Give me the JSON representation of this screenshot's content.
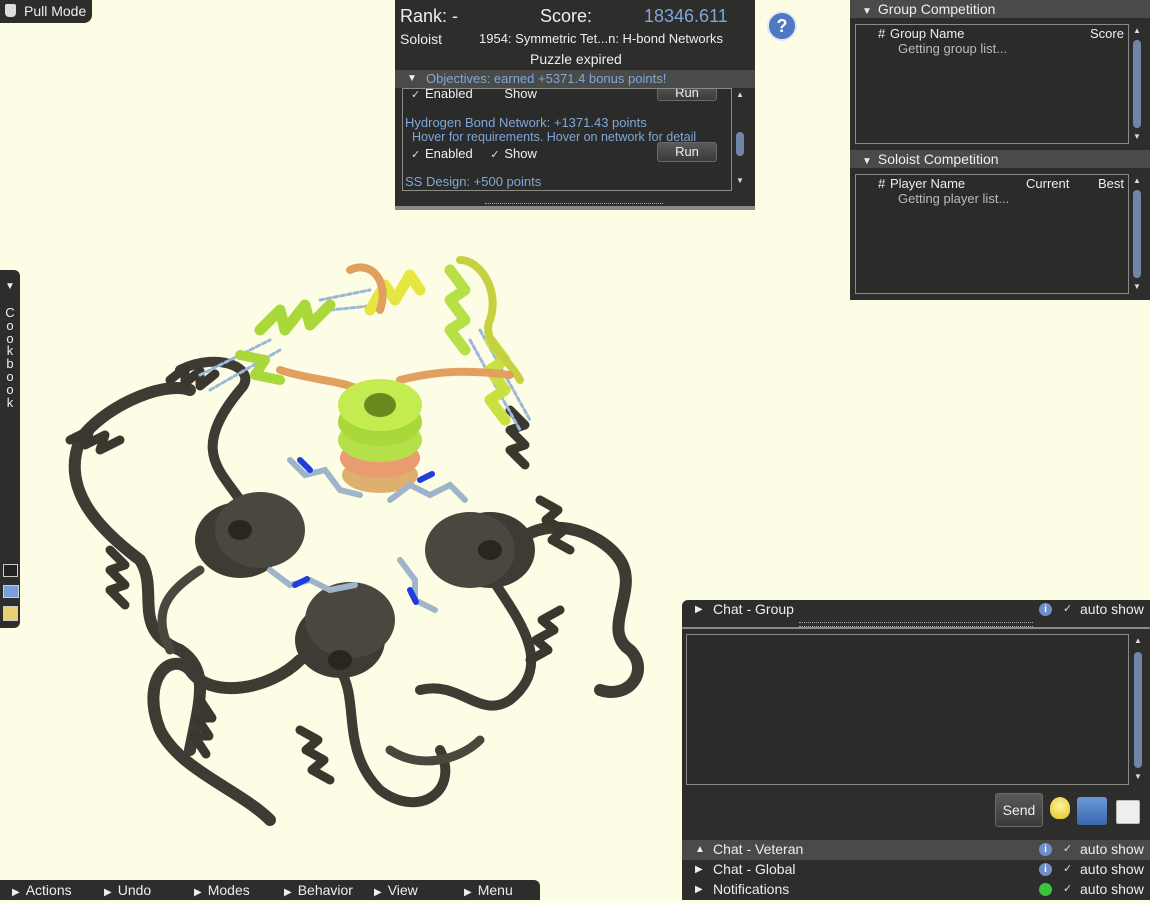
{
  "mode_button": {
    "label": "Pull Mode"
  },
  "score_panel": {
    "rank_label": "Rank: -",
    "score_label": "Score:",
    "score_value": "18346.611",
    "soloist": "Soloist",
    "puzzle_title": "1954: Symmetric Tet...n: H-bond Networks",
    "status": "Puzzle expired"
  },
  "objectives": {
    "header": "Objectives: earned +5371.4 bonus points!",
    "items": [
      {
        "enabled_label": "Enabled",
        "show_label": "Show",
        "run_label": "Run"
      },
      {
        "title": "Hydrogen Bond Network: +1371.43 points",
        "hint": "Hover for requirements. Hover on network for detail",
        "enabled_label": "Enabled",
        "show_label": "Show",
        "run_label": "Run"
      },
      {
        "title": "SS Design: +500 points"
      }
    ]
  },
  "help_icon": "?",
  "group_competition": {
    "title": "Group Competition",
    "col_rank": "#",
    "col_name": "Group Name",
    "col_score": "Score",
    "loading": "Getting group list..."
  },
  "soloist_competition": {
    "title": "Soloist Competition",
    "col_rank": "#",
    "col_name": "Player Name",
    "col_current": "Current",
    "col_best": "Best",
    "loading": "Getting player list..."
  },
  "cookbook": {
    "letters": [
      "C",
      "o",
      "o",
      "k",
      "b",
      "o",
      "o",
      "k"
    ]
  },
  "chat": {
    "group_title": "Chat - Group",
    "auto_show": "auto show",
    "send_label": "Send",
    "tabs": [
      {
        "title": "Chat - Veteran",
        "auto_show": "auto show"
      },
      {
        "title": "Chat - Global",
        "auto_show": "auto show"
      },
      {
        "title": "Notifications",
        "auto_show": "auto show"
      }
    ]
  },
  "bottom_menu": [
    "Actions",
    "Undo",
    "Modes",
    "Behavior",
    "View",
    "Menu"
  ],
  "colors": {
    "panel_bg": "#2d2d2b",
    "accent_blue": "#7fa7d8",
    "canvas_bg": "#fdfde6",
    "protein_dark": "#3e3b34",
    "protein_green": "#a8d83a",
    "protein_yellow": "#e6e640",
    "protein_orange": "#e0a060",
    "hbond_blue": "#1e3ce0"
  },
  "icons": [
    "help-icon",
    "cookbook-icon",
    "script-icon",
    "open-icon",
    "notes-icon",
    "lightbulb-icon",
    "download-icon",
    "clock-icon",
    "info-icon",
    "notification-icon"
  ]
}
